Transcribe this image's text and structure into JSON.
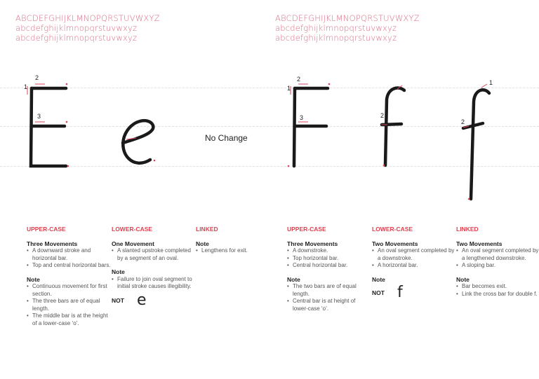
{
  "alphabet_left": {
    "upper": "ABCDEFGHIJKLMNOPQRSTUVWXYZ",
    "lower": "abcdefghijklmnopqrstuvwxyz",
    "linked": "abcdefghijklmnopqrstuvwxyz"
  },
  "alphabet_right": {
    "upper": "ABCDEFGHIJKLMNOPQRSTUVWXYZ",
    "lower": "abcdefghijklmnopqrstuvwxyz",
    "linked": "abcdefghijklmnopqrstuvwxyz"
  },
  "stroke_numbers": {
    "e1": "1",
    "e2": "2",
    "e3": "3",
    "f1": "1",
    "f2": "2",
    "f3": "3",
    "lf2": "2",
    "kf1": "1",
    "kf2": "2"
  },
  "no_change": "No Change",
  "columns": [
    {
      "heading": "UPPER-CASE",
      "sections": [
        {
          "title": "Three Movements",
          "items": [
            "A downward stroke and horizontal bar.",
            "Top and central horizontal bars."
          ]
        },
        {
          "title": "Note",
          "items": [
            "Continuous movement for first section.",
            "The three bars are of equal length.",
            "The middle bar is at the height of a lower-case ‘o’."
          ]
        }
      ]
    },
    {
      "heading": "LOWER-CASE",
      "sections": [
        {
          "title": "One Movement",
          "items": [
            "A slanted upstroke completed by a segment of an oval."
          ]
        },
        {
          "title": "Note",
          "items": [
            "Failure to join oval segment to initial stroke causes illegibility."
          ]
        }
      ],
      "not_label": "NOT",
      "not_glyph": "e"
    },
    {
      "heading": "LINKED",
      "sections": [
        {
          "title": "Note",
          "items": [
            "Lengthens for exit."
          ]
        }
      ]
    },
    {
      "heading": "UPPER-CASE",
      "sections": [
        {
          "title": "Three Movements",
          "items": [
            "A downstroke.",
            "Top horizontal bar.",
            "Central horizontal bar."
          ]
        },
        {
          "title": "Note",
          "items": [
            "The two bars are of equal length.",
            "Central bar is at height of lower-case ‘o’."
          ]
        }
      ]
    },
    {
      "heading": "LOWER-CASE",
      "sections": [
        {
          "title": "Two Movements",
          "items": [
            "An oval segment completed by a downstroke.",
            "A horizontal bar."
          ]
        },
        {
          "title": "Note",
          "items": []
        }
      ],
      "not_label": "NOT",
      "not_glyph": "f"
    },
    {
      "heading": "LINKED",
      "sections": [
        {
          "title": "Two Movements",
          "items": [
            "An oval segment completed by a lengthened downstroke.",
            "A sloping bar."
          ]
        },
        {
          "title": "Note",
          "items": [
            "Bar becomes exit.",
            "Link the cross bar for double f."
          ]
        }
      ]
    }
  ],
  "colors": {
    "accent": "#e0404f",
    "alphabet": "#d96a82",
    "ink": "#1a1a1a"
  }
}
